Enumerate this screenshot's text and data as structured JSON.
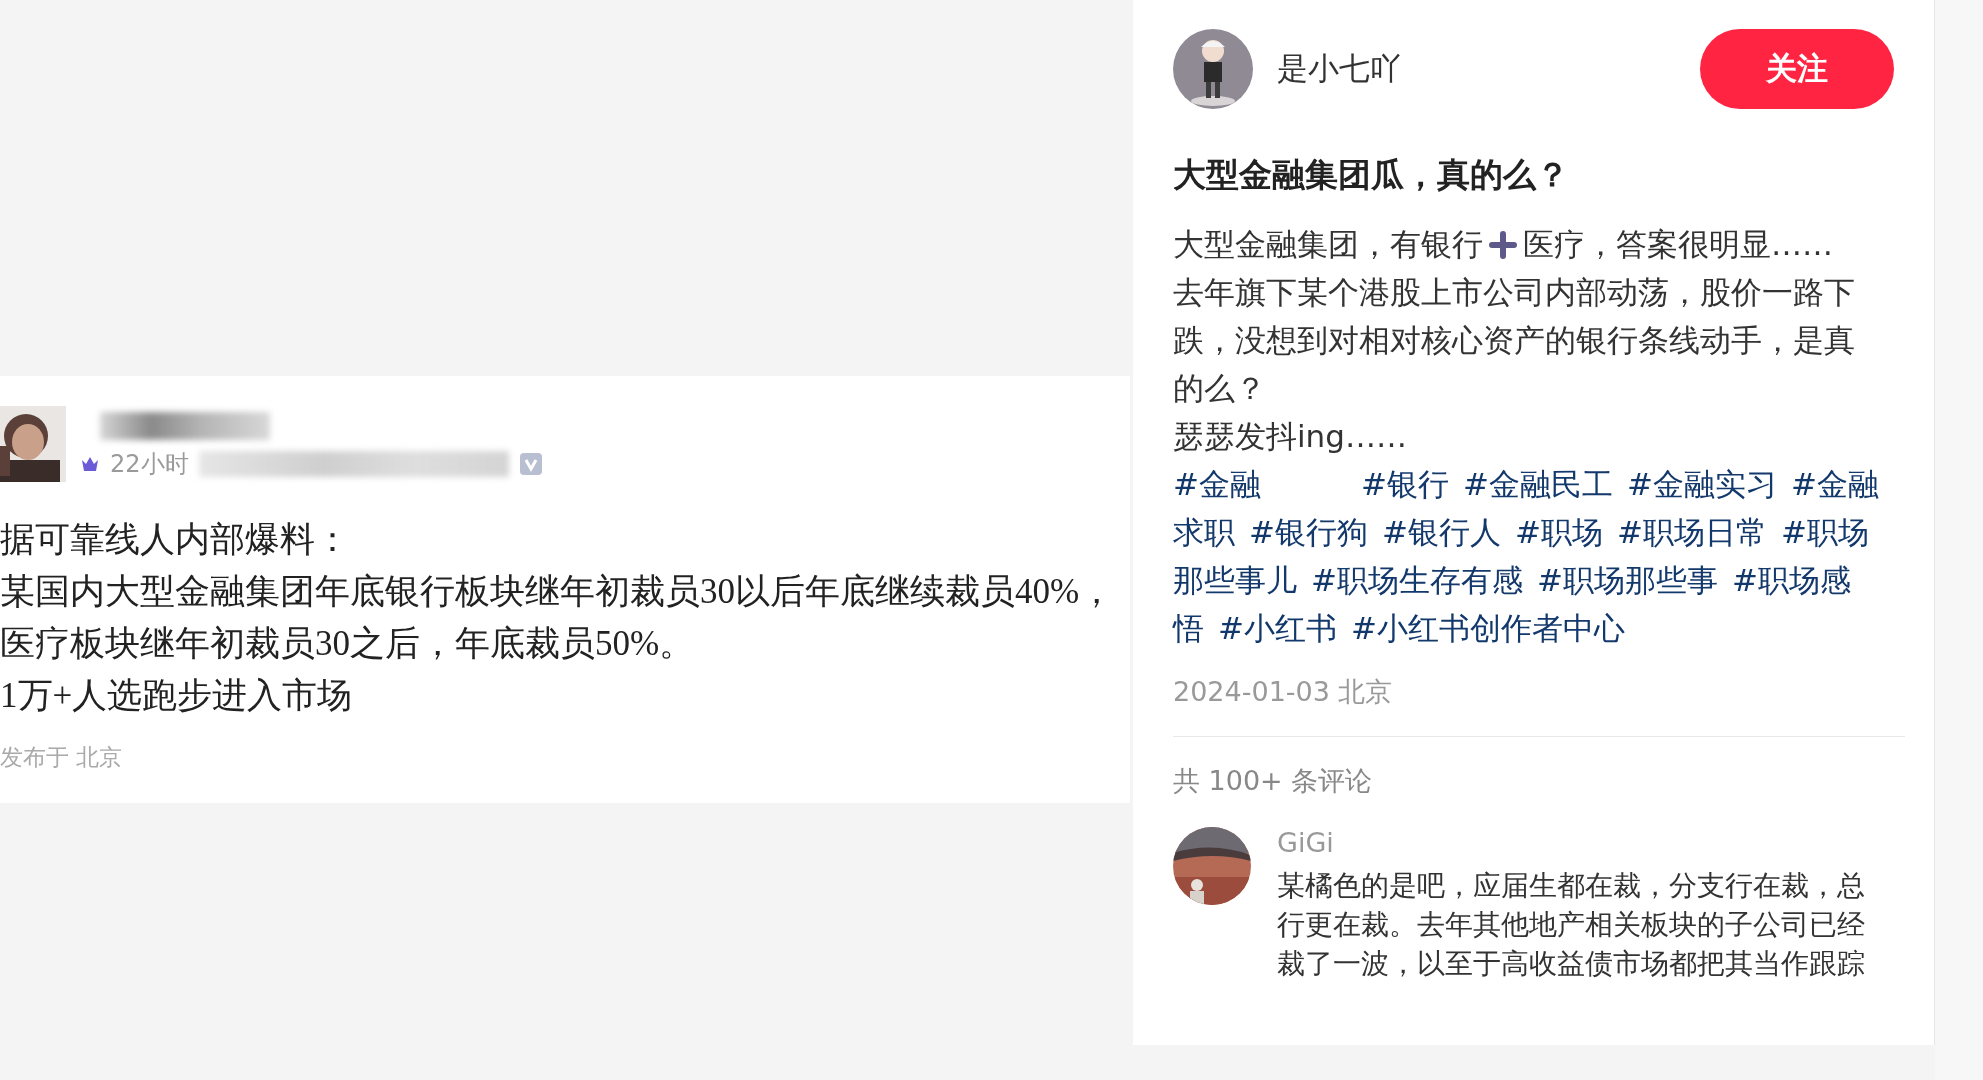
{
  "left_post": {
    "time": "22小时",
    "lines": [
      "据可靠线人内部爆料：",
      "某国内大型金融集团年底银行板块继年初裁员30以后年底继续裁员40%，",
      "医疗板块继年初裁员30之后，年底裁员50%。",
      "1万+人选跑步进入市场"
    ],
    "location": "发布于 北京"
  },
  "note": {
    "author": "是小七吖",
    "follow_button": "关注",
    "title": "大型金融集团瓜，真的么？",
    "intro_before": "大型金融集团，有银行",
    "intro_after": "医疗，答案很明显……",
    "paragraph": "去年旗下某个港股上市公司内部动荡，股价一路下跌，没想到对相对核心资产的银行条线动手，是真的么？",
    "closing": "瑟瑟发抖ing……",
    "hashtags": [
      "#金融",
      "#银行",
      "#金融民工",
      "#金融实习",
      "#金融求职",
      "#银行狗",
      "#银行人",
      "#职场",
      "#职场日常",
      "#职场那些事儿",
      "#职场生存有感",
      "#职场那些事",
      "#职场感悟",
      "#小红书",
      "#小红书创作者中心"
    ],
    "date_location": "2024-01-03 北京",
    "comment_count": "共 100+ 条评论",
    "comments": [
      {
        "author": "GiGi",
        "text": "某橘色的是吧，应届生都在裁，分支行在裁，总行更在裁。去年其他地产相关板块的子公司已经裁了一波，以至于高收益债市场都把其当作跟踪"
      }
    ]
  }
}
